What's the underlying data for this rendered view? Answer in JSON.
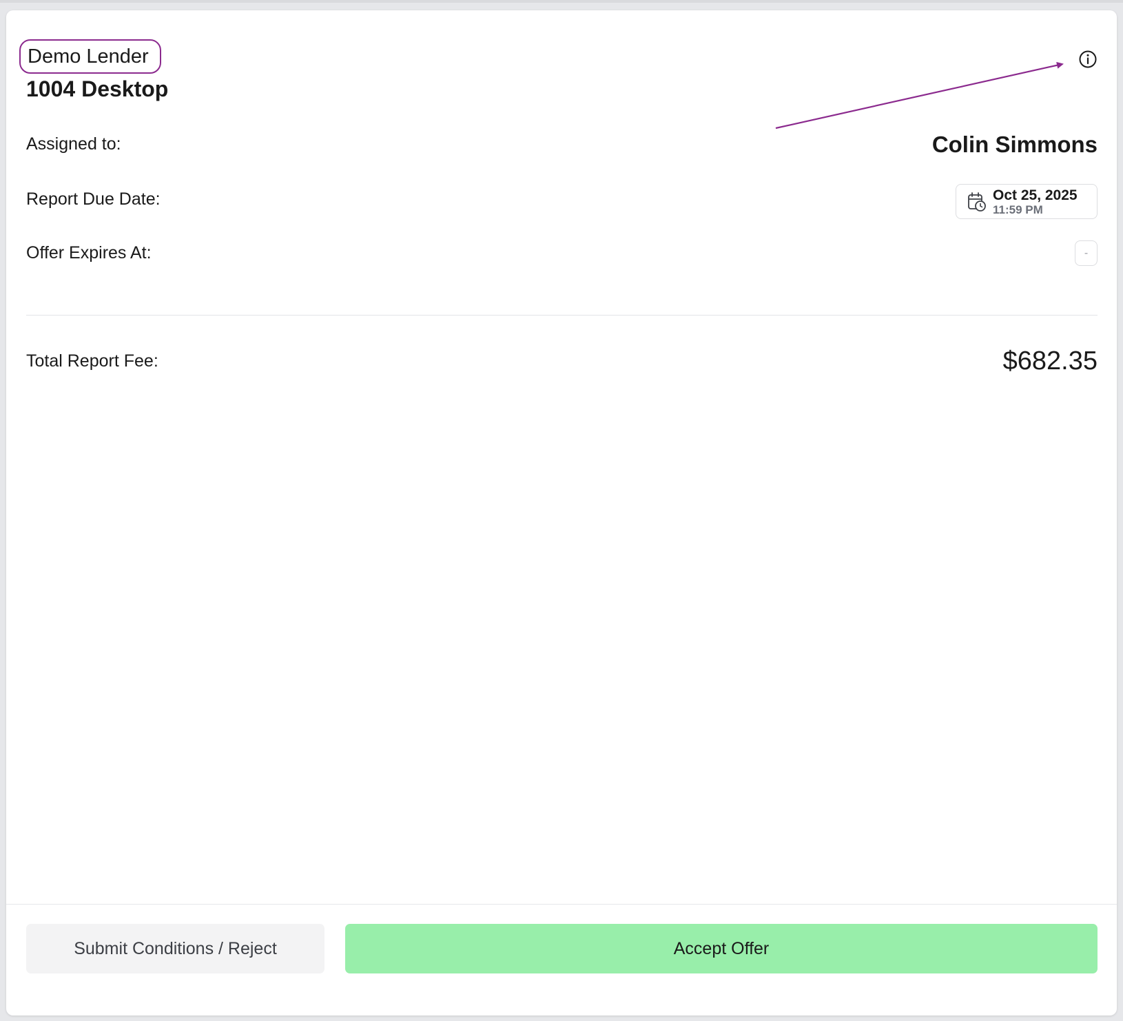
{
  "header": {
    "lender": "Demo Lender",
    "report_type": "1004 Desktop",
    "info_icon": "info-circle-icon"
  },
  "details": {
    "assigned_label": "Assigned to:",
    "assigned_name": "Colin Simmons",
    "due_label": "Report Due Date:",
    "due_date": "Oct 25, 2025",
    "due_time": "11:59 PM",
    "due_icon": "calendar-clock-icon",
    "expires_label": "Offer Expires At:",
    "expires_value": "-"
  },
  "fee": {
    "label": "Total Report Fee:",
    "amount": "$682.35"
  },
  "actions": {
    "reject_label": "Submit Conditions / Reject",
    "accept_label": "Accept Offer"
  },
  "colors": {
    "annotation": "#8b2a8e",
    "accept_button": "#98eeaa",
    "reject_button": "#f3f3f4"
  }
}
